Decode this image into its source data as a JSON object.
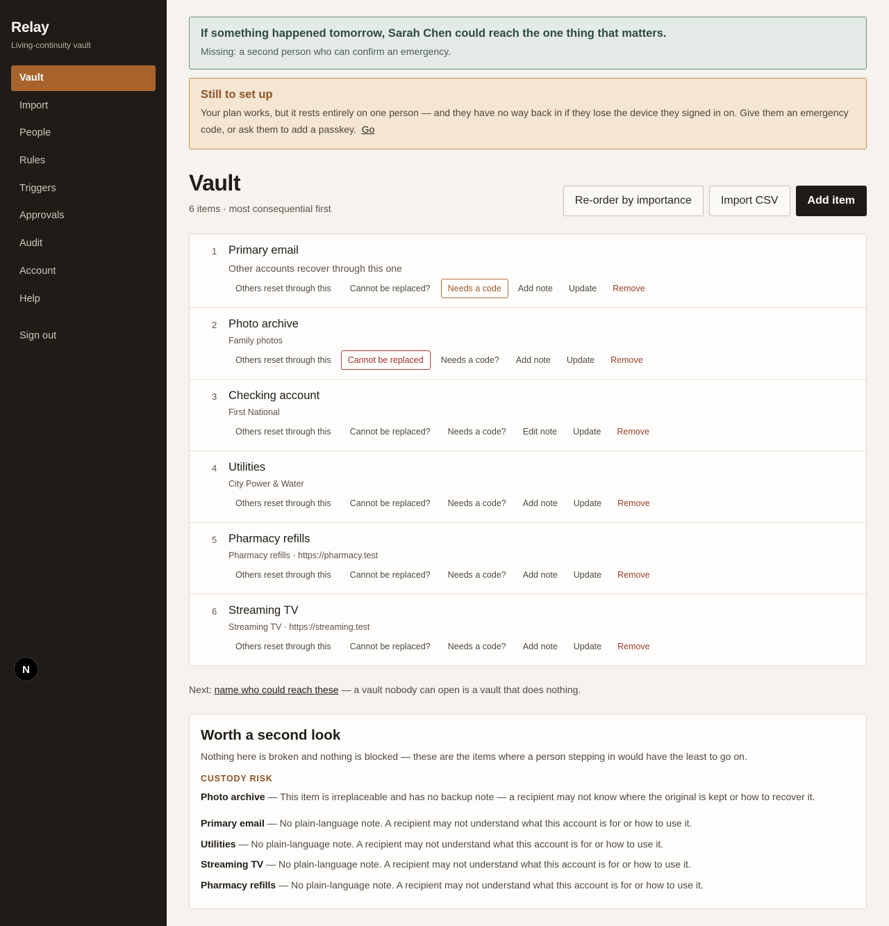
{
  "app": {
    "name": "Relay",
    "tagline": "Living-continuity vault"
  },
  "sidebar": {
    "items": [
      {
        "label": "Vault",
        "active": true
      },
      {
        "label": "Import"
      },
      {
        "label": "People"
      },
      {
        "label": "Rules"
      },
      {
        "label": "Triggers"
      },
      {
        "label": "Approvals"
      },
      {
        "label": "Audit"
      },
      {
        "label": "Account"
      },
      {
        "label": "Help"
      }
    ],
    "sign_out": "Sign out",
    "avatar_letter": "N"
  },
  "banner_ok": {
    "title": "If something happened tomorrow, Sarah Chen could reach the one thing that matters.",
    "subtitle": "Missing: a second person who can confirm an emergency."
  },
  "banner_warn": {
    "title": "Still to set up",
    "body": "Your plan works, but it rests entirely on one person — and they have no way back in if they lose the device they signed in on. Give them an emergency code, or ask them to add a passkey.",
    "link": "Go"
  },
  "vault": {
    "title": "Vault",
    "subtitle": "6 items · most consequential first",
    "buttons": {
      "reorder": "Re-order by importance",
      "import": "Import CSV",
      "add": "Add item"
    }
  },
  "items": [
    {
      "num": "1",
      "name": "Primary email",
      "desc": "Other accounts recover through this one",
      "reset": "Others reset through this",
      "replace": "Cannot be replaced?",
      "code": "Needs a code",
      "note": "Add note",
      "update": "Update",
      "remove": "Remove"
    },
    {
      "num": "2",
      "name": "Photo archive",
      "desc": "Family photos",
      "reset": "Others reset through this",
      "replace": "Cannot be replaced",
      "code": "Needs a code?",
      "note": "Add note",
      "update": "Update",
      "remove": "Remove"
    },
    {
      "num": "3",
      "name": "Checking account",
      "desc": "First National",
      "reset": "Others reset through this",
      "replace": "Cannot be replaced?",
      "code": "Needs a code?",
      "note": "Edit note",
      "update": "Update",
      "remove": "Remove"
    },
    {
      "num": "4",
      "name": "Utilities",
      "desc": "City Power & Water",
      "reset": "Others reset through this",
      "replace": "Cannot be replaced?",
      "code": "Needs a code?",
      "note": "Add note",
      "update": "Update",
      "remove": "Remove"
    },
    {
      "num": "5",
      "name": "Pharmacy refills",
      "desc": "Pharmacy refills · https://pharmacy.test",
      "reset": "Others reset through this",
      "replace": "Cannot be replaced?",
      "code": "Needs a code?",
      "note": "Add note",
      "update": "Update",
      "remove": "Remove"
    },
    {
      "num": "6",
      "name": "Streaming TV",
      "desc": "Streaming TV · https://streaming.test",
      "reset": "Others reset through this",
      "replace": "Cannot be replaced?",
      "code": "Needs a code?",
      "note": "Add note",
      "update": "Update",
      "remove": "Remove"
    }
  ],
  "next": {
    "prefix": "Next:",
    "link": "name who could reach these",
    "suffix": "— a vault nobody can open is a vault that does nothing."
  },
  "second_look": {
    "title": "Worth a second look",
    "subtitle": "Nothing here is broken and nothing is blocked — these are the items where a person stepping in would have the least to go on.",
    "kicker": "CUSTODY RISK",
    "risks": [
      {
        "name": "Photo archive",
        "text": "— This item is irreplaceable and has no backup note — a recipient may not know where the original is kept or how to recover it."
      },
      {
        "name": "Primary email",
        "text": "— No plain-language note. A recipient may not understand what this account is for or how to use it."
      },
      {
        "name": "Utilities",
        "text": "— No plain-language note. A recipient may not understand what this account is for or how to use it."
      },
      {
        "name": "Streaming TV",
        "text": "— No plain-language note. A recipient may not understand what this account is for or how to use it."
      },
      {
        "name": "Pharmacy refills",
        "text": "— No plain-language note. A recipient may not understand what this account is for or how to use it."
      }
    ]
  },
  "colors": {
    "sidebar_bg": "#1f1b17",
    "accent": "#a8632c",
    "danger": "#9a3f2a",
    "ok_border": "#6f8f7f",
    "warn_border": "#c88c55"
  }
}
